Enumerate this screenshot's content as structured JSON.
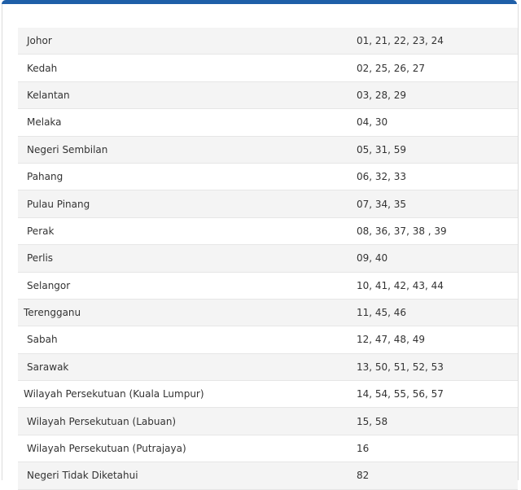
{
  "rows": [
    {
      "state": "Johor",
      "codes": "01, 21, 22, 23, 24"
    },
    {
      "state": "Kedah",
      "codes": "02, 25, 26, 27"
    },
    {
      "state": "Kelantan",
      "codes": "03, 28, 29"
    },
    {
      "state": "Melaka",
      "codes": "04, 30"
    },
    {
      "state": "Negeri Sembilan",
      "codes": "05, 31, 59"
    },
    {
      "state": "Pahang",
      "codes": "06, 32, 33"
    },
    {
      "state": "Pulau Pinang",
      "codes": "07, 34, 35"
    },
    {
      "state": "Perak",
      "codes": "08, 36, 37, 38 , 39"
    },
    {
      "state": "Perlis",
      "codes": "09, 40"
    },
    {
      "state": "Selangor",
      "codes": "10, 41, 42, 43, 44"
    },
    {
      "state": "Terengganu",
      "codes": "11, 45, 46"
    },
    {
      "state": "Sabah",
      "codes": "12, 47, 48, 49"
    },
    {
      "state": "Sarawak",
      "codes": "13, 50, 51, 52, 53"
    },
    {
      "state": "Wilayah Persekutuan (Kuala Lumpur)",
      "codes": "14, 54, 55, 56, 57"
    },
    {
      "state": "Wilayah Persekutuan (Labuan)",
      "codes": "15, 58"
    },
    {
      "state": "Wilayah Persekutuan (Putrajaya)",
      "codes": "16"
    },
    {
      "state": "Negeri Tidak Diketahui",
      "codes": "82"
    }
  ]
}
